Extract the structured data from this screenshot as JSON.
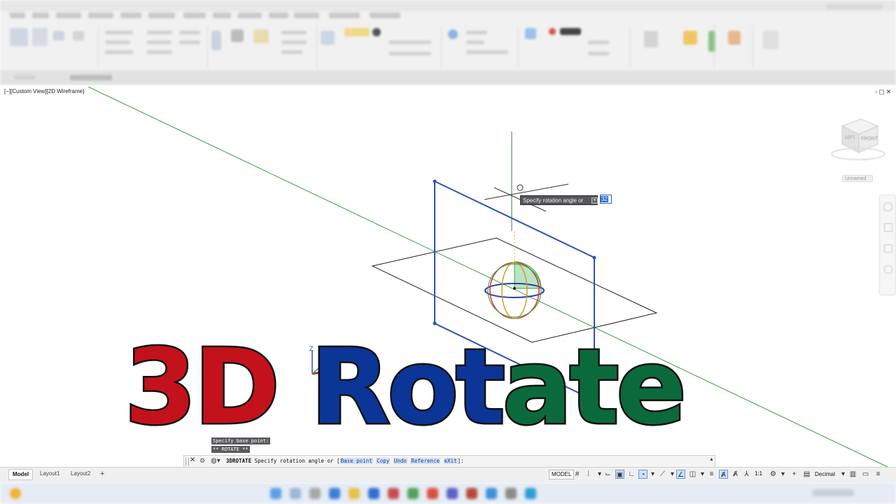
{
  "viewport": {
    "label": "[−][Custom View][2D Wireframe]",
    "controls": "▫▢✕",
    "tooltip": {
      "prompt": "Specify rotation angle or",
      "value": "32"
    },
    "viewcube": {
      "face_front": "FRONT",
      "face_left": "LEFT",
      "named_view": "Unnamed"
    },
    "ucs": {
      "z": "Z",
      "x": "X"
    }
  },
  "overlay_title": {
    "part1": "3D",
    "part2": "Rot",
    "part3": "ate",
    "colors": {
      "part1": "#c3121b",
      "part2": "#0b3596",
      "part3": "#0b6a3b"
    }
  },
  "history": [
    "Specify base point:",
    "** ROTATE **"
  ],
  "command_line": {
    "command": "3DROTATE",
    "prompt": "Specify rotation angle or [",
    "options": [
      "Base point",
      "Copy",
      "Undo",
      "Reference",
      "eXit"
    ],
    "end": "]:",
    "close_icon": "✕",
    "expand_icon": "▲"
  },
  "status": {
    "tabs": [
      "Model",
      "Layout1",
      "Layout2",
      "+"
    ],
    "model_button": "MODEL",
    "scale": "1:1",
    "units": "Decimal"
  },
  "icons": [
    "grid-icon",
    "snap-icon",
    "ortho-icon",
    "polar-icon",
    "osnap-icon",
    "lineweight-icon",
    "annotation-icon",
    "workspace-icon",
    "plus-icon",
    "customize-icon"
  ]
}
